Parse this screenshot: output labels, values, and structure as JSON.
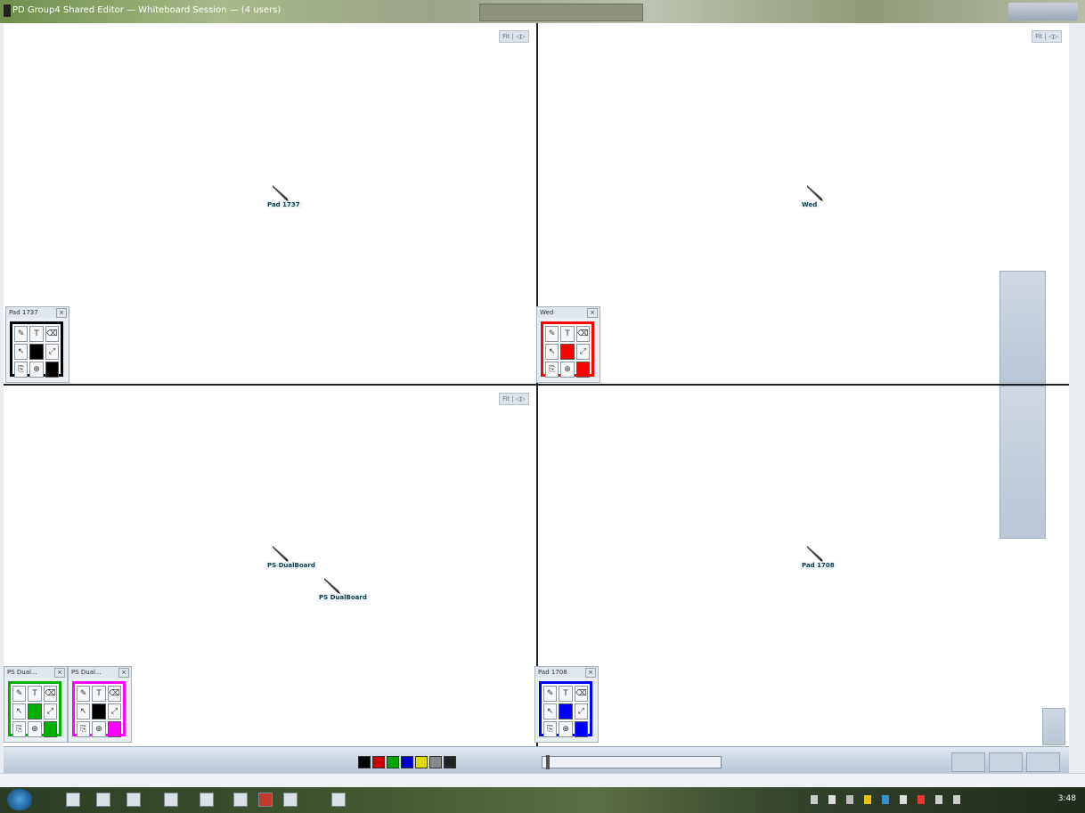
{
  "window": {
    "title": "PD Group4 Shared Editor — Whiteboard Session — (4 users)"
  },
  "panes": {
    "top_left": {
      "corner_label": "Fit | ◁▷",
      "cursor_label": "Pad 1737"
    },
    "top_right": {
      "corner_label": "Fit | ◁▷",
      "cursor_label": "Wed"
    },
    "bottom_left": {
      "corner_label": "Fit | ◁▷",
      "cursor_label_a": "PS DualBoard",
      "cursor_label_b": "PS DualBoard"
    },
    "bottom_right": {
      "cursor_label": "Pad 1708"
    }
  },
  "palettes": [
    {
      "title": "Pad 1737",
      "color": "#000000"
    },
    {
      "title": "Wed",
      "color": "#ff0000"
    },
    {
      "title": "PS Dual...",
      "color": "#00b000"
    },
    {
      "title": "PS Dual...",
      "color": "#ff00ff"
    },
    {
      "title": "Pad 1708",
      "color": "#0000ff"
    }
  ],
  "tools": [
    "✎",
    "T",
    "⌫",
    "↖",
    "",
    "⤢",
    "⎘",
    "⊕",
    ""
  ],
  "toolbar": {
    "colors": [
      "#000000",
      "#cc0000",
      "#00aa00",
      "#0000cc",
      "#dddd00",
      "#888888",
      "#222222"
    ]
  },
  "tray": {
    "clock": "3:48"
  }
}
